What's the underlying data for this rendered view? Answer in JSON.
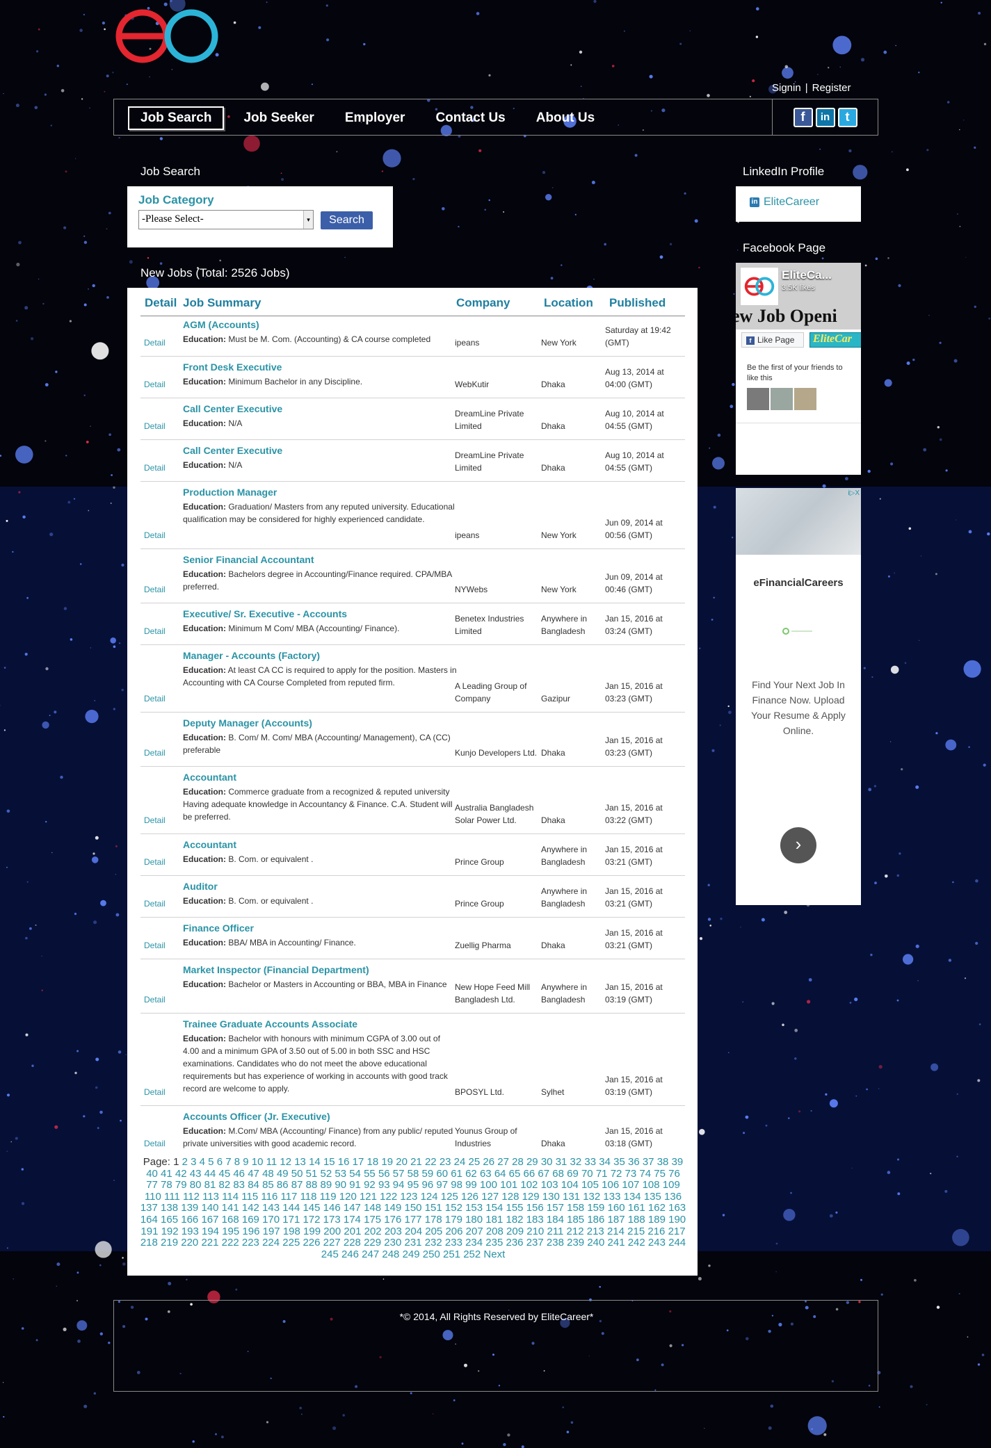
{
  "brand": {
    "logo_alt": "eo",
    "colors": {
      "red": "#e3262f",
      "blue": "#2cb4d8",
      "link": "#2a93a6"
    }
  },
  "auth": {
    "signin": "Signin",
    "separator": "|",
    "register": "Register"
  },
  "nav": {
    "items": [
      "Job Search",
      "Job Seeker",
      "Employer",
      "Contact Us",
      "About Us"
    ],
    "active": "Job Search",
    "social": [
      "facebook-icon",
      "linkedin-icon",
      "twitter-icon"
    ]
  },
  "job_search": {
    "title": "Job Search",
    "category_label": "Job Category",
    "select_value": "-Please Select-",
    "search_button": "Search"
  },
  "new_jobs": {
    "title": "New Jobs (Total: 2526 Jobs)",
    "columns": {
      "detail": "Detail",
      "summary": "Job Summary",
      "company": "Company",
      "location": "Location",
      "published": "Published"
    },
    "detail_label": "Detail",
    "education_label": "Education:",
    "rows": [
      {
        "title": "AGM (Accounts)",
        "education": "Must be M. Com. (Accounting) & CA course completed",
        "company": "ipeans",
        "location": "New York",
        "published": "Saturday at 19:42 (GMT)"
      },
      {
        "title": "Front Desk Executive",
        "education": "Minimum Bachelor in any Discipline.",
        "company": "WebKutir",
        "location": "Dhaka",
        "published": "Aug 13, 2014 at 04:00 (GMT)"
      },
      {
        "title": "Call Center Executive",
        "education": "N/A",
        "company": "DreamLine Private Limited",
        "location": "Dhaka",
        "published": "Aug 10, 2014 at 04:55 (GMT)"
      },
      {
        "title": "Call Center Executive",
        "education": "N/A",
        "company": "DreamLine Private Limited",
        "location": "Dhaka",
        "published": "Aug 10, 2014 at 04:55 (GMT)"
      },
      {
        "title": "Production Manager",
        "education": "Graduation/ Masters from any reputed university. Educational qualification may be considered for highly experienced candidate.",
        "company": "ipeans",
        "location": "New York",
        "published": "Jun 09, 2014 at 00:56 (GMT)"
      },
      {
        "title": "Senior Financial Accountant",
        "education": "Bachelors degree in Accounting/Finance required. CPA/MBA preferred.",
        "company": "NYWebs",
        "location": "New York",
        "published": "Jun 09, 2014 at 00:46 (GMT)"
      },
      {
        "title": "Executive/ Sr. Executive - Accounts",
        "education": "Minimum M Com/ MBA (Accounting/ Finance).",
        "company": "Benetex Industries Limited",
        "location": "Anywhere in Bangladesh",
        "published": "Jan 15, 2016 at 03:24 (GMT)"
      },
      {
        "title": "Manager - Accounts (Factory)",
        "education": "At least CA CC is required to apply for the position. Masters in Accounting with CA Course Completed from reputed firm.",
        "company": "A Leading Group of Company",
        "location": "Gazipur",
        "published": "Jan 15, 2016 at 03:23 (GMT)"
      },
      {
        "title": "Deputy Manager (Accounts)",
        "education": "B. Com/ M. Com/ MBA (Accounting/ Management), CA (CC) preferable",
        "company": "Kunjo Developers Ltd.",
        "location": "Dhaka",
        "published": "Jan 15, 2016 at 03:23 (GMT)"
      },
      {
        "title": "Accountant",
        "education": "Commerce graduate from a recognized & reputed university Having adequate knowledge in Accountancy & Finance. C.A. Student will be preferred.",
        "company": "Australia Bangladesh Solar Power Ltd.",
        "location": "Dhaka",
        "published": "Jan 15, 2016 at 03:22 (GMT)"
      },
      {
        "title": "Accountant",
        "education": "B. Com. or equivalent .",
        "company": "Prince Group",
        "location": "Anywhere in Bangladesh",
        "published": "Jan 15, 2016 at 03:21 (GMT)"
      },
      {
        "title": "Auditor",
        "education": "B. Com. or equivalent .",
        "company": "Prince Group",
        "location": "Anywhere in Bangladesh",
        "published": "Jan 15, 2016 at 03:21 (GMT)"
      },
      {
        "title": "Finance Officer",
        "education": "BBA/ MBA in Accounting/ Finance.",
        "company": "Zuellig Pharma",
        "location": "Dhaka",
        "published": "Jan 15, 2016 at 03:21 (GMT)"
      },
      {
        "title": "Market Inspector (Financial Department)",
        "education": "Bachelor or Masters in Accounting or BBA, MBA in Finance",
        "company": "New Hope Feed Mill Bangladesh Ltd.",
        "location": "Anywhere in Bangladesh",
        "published": "Jan 15, 2016 at 03:19 (GMT)"
      },
      {
        "title": "Trainee Graduate Accounts Associate",
        "education": "Bachelor with honours with minimum CGPA of 3.00 out of 4.00 and a minimum GPA of 3.50 out of 5.00 in both SSC and HSC examinations. Candidates who do not meet the above educational requirements but has experience of working in accounts with good track record are welcome to apply.",
        "company": "BPOSYL Ltd.",
        "location": "Sylhet",
        "published": "Jan 15, 2016 at 03:19 (GMT)"
      },
      {
        "title": "Accounts Officer (Jr. Executive)",
        "education": "M.Com/ MBA (Accounting/ Finance) from any public/ reputed private universities with good academic record.",
        "company": "Younus Group of Industries",
        "location": "Dhaka",
        "published": "Jan 15, 2016 at 03:18 (GMT)"
      }
    ]
  },
  "pagination": {
    "label": "Page:",
    "current": 1,
    "last": 252,
    "next": "Next"
  },
  "linkedin": {
    "title": "LinkedIn Profile",
    "link": "EliteCareer"
  },
  "facebook": {
    "title": "Facebook Page",
    "page_name": "EliteCa...",
    "likes": "3.5K likes",
    "banner": "ew Job Openi",
    "like_button": "Like Page",
    "brand_tag": "EliteCar",
    "friends_text": "Be the first of your friends to like this"
  },
  "ad": {
    "brand": "eFinancialCareers",
    "copy": "Find Your Next Job In Finance Now. Upload Your Resume & Apply Online.",
    "badge": "i▷X"
  },
  "footer": {
    "text": "*© 2014, All Rights Reserved by EliteCareer*"
  }
}
